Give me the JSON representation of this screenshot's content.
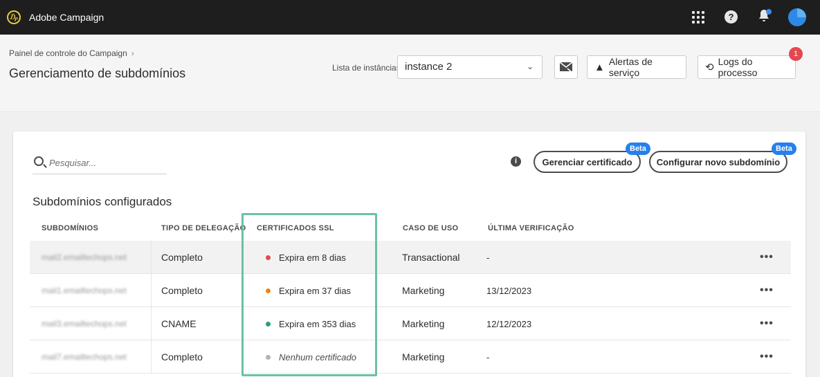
{
  "app": {
    "title": "Adobe Campaign"
  },
  "header": {
    "breadcrumb": "Painel de controle do Campaign",
    "page_title": "Gerenciamento de subdomínios",
    "instance_label": "Lista de instâncias",
    "instance_value": "instance 2",
    "alerts_button": "Alertas de serviço",
    "logs_button": "Logs do processo",
    "logs_badge": "1"
  },
  "toolbar": {
    "search_placeholder": "Pesquisar...",
    "manage_cert": "Gerenciar certificado",
    "new_subdomain": "Configurar novo subdomínio",
    "beta_label": "Beta"
  },
  "table": {
    "title": "Subdomínios configurados",
    "columns": [
      "SUBDOMÍNIOS",
      "TIPO DE DELEGAÇÃO",
      "CERTIFICADOS SSL",
      "CASO DE USO",
      "ÚLTIMA VERIFICAÇÃO"
    ],
    "rows": [
      {
        "subdomain": "mail2.emailtechops.net",
        "delegation": "Completo",
        "ssl": "Expira em 8 dias",
        "ssl_color": "#e34850",
        "use_case": "Transactional",
        "last_check": "-"
      },
      {
        "subdomain": "mail1.emailtechops.net",
        "delegation": "Completo",
        "ssl": "Expira em 37 dias",
        "ssl_color": "#e68619",
        "use_case": "Marketing",
        "last_check": "13/12/2023"
      },
      {
        "subdomain": "mail3.emailtechops.net",
        "delegation": "CNAME",
        "ssl": "Expira em 353 dias",
        "ssl_color": "#2d9d78",
        "use_case": "Marketing",
        "last_check": "12/12/2023"
      },
      {
        "subdomain": "mail7.emailtechops.net",
        "delegation": "Completo",
        "ssl": "Nenhum certificado",
        "ssl_color": "#b3b3b3",
        "use_case": "Marketing",
        "last_check": "-"
      }
    ],
    "row_menu": "•••"
  },
  "colors": {
    "accent": "#2680eb",
    "highlight": "#6bbfa8",
    "topbar": "#1e1e1e"
  }
}
